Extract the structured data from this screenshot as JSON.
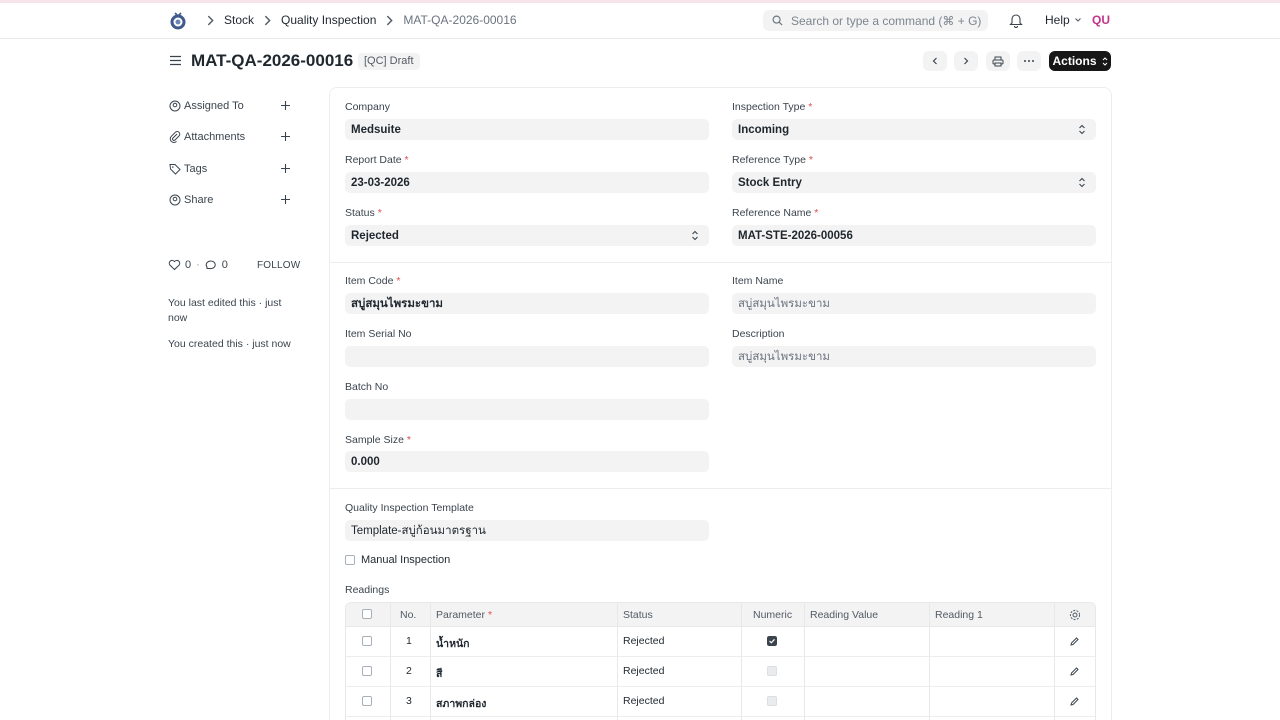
{
  "navbar": {
    "breadcrumbs": [
      "Stock",
      "Quality Inspection",
      "MAT-QA-2026-00016"
    ],
    "search_placeholder": "Search or type a command (⌘ + G)",
    "help_label": "Help",
    "avatar_initials": "QU"
  },
  "page": {
    "title": "MAT-QA-2026-00016",
    "status_badge": "[QC] Draft",
    "actions_label": "Actions"
  },
  "sidebar": {
    "items": [
      {
        "label": "Assigned To",
        "icon": "assign-icon"
      },
      {
        "label": "Attachments",
        "icon": "paperclip-icon"
      },
      {
        "label": "Tags",
        "icon": "tag-icon"
      },
      {
        "label": "Share",
        "icon": "share-icon"
      }
    ],
    "likes": "0",
    "comments": "0",
    "follow_label": "FOLLOW",
    "activity": [
      "You last edited this · just now",
      "You created this · just now"
    ]
  },
  "form": {
    "company": {
      "label": "Company",
      "value": "Medsuite"
    },
    "inspection_type": {
      "label": "Inspection Type",
      "value": "Incoming"
    },
    "report_date": {
      "label": "Report Date",
      "value": "23-03-2026"
    },
    "reference_type": {
      "label": "Reference Type",
      "value": "Stock Entry"
    },
    "status": {
      "label": "Status",
      "value": "Rejected"
    },
    "reference_name": {
      "label": "Reference Name",
      "value": "MAT-STE-2026-00056"
    },
    "item_code": {
      "label": "Item Code",
      "value": "สบู่สมุนไพรมะขาม"
    },
    "item_name": {
      "label": "Item Name",
      "value": "สบู่สมุนไพรมะขาม"
    },
    "item_serial_no": {
      "label": "Item Serial No",
      "value": ""
    },
    "description": {
      "label": "Description",
      "value": "สบู่สมุนไพรมะขาม"
    },
    "batch_no": {
      "label": "Batch No",
      "value": ""
    },
    "sample_size": {
      "label": "Sample Size",
      "value": "0.000"
    },
    "template": {
      "label": "Quality Inspection Template",
      "value": "Template-สบู่ก้อนมาตรฐาน"
    },
    "manual_inspection": {
      "label": "Manual Inspection",
      "checked": false
    },
    "readings_label": "Readings"
  },
  "readings": {
    "columns": [
      "No.",
      "Parameter",
      "Status",
      "Numeric",
      "Reading Value",
      "Reading 1"
    ],
    "rows": [
      {
        "no": "1",
        "parameter": "น้ำหนัก",
        "status": "Rejected",
        "numeric": true
      },
      {
        "no": "2",
        "parameter": "สี",
        "status": "Rejected",
        "numeric": false
      },
      {
        "no": "3",
        "parameter": "สภาพกล่อง",
        "status": "Rejected",
        "numeric": false
      }
    ]
  },
  "colors": {
    "primary_button": "#171717",
    "required_marker": "#e24c4c",
    "avatar_text": "#c2348a"
  }
}
